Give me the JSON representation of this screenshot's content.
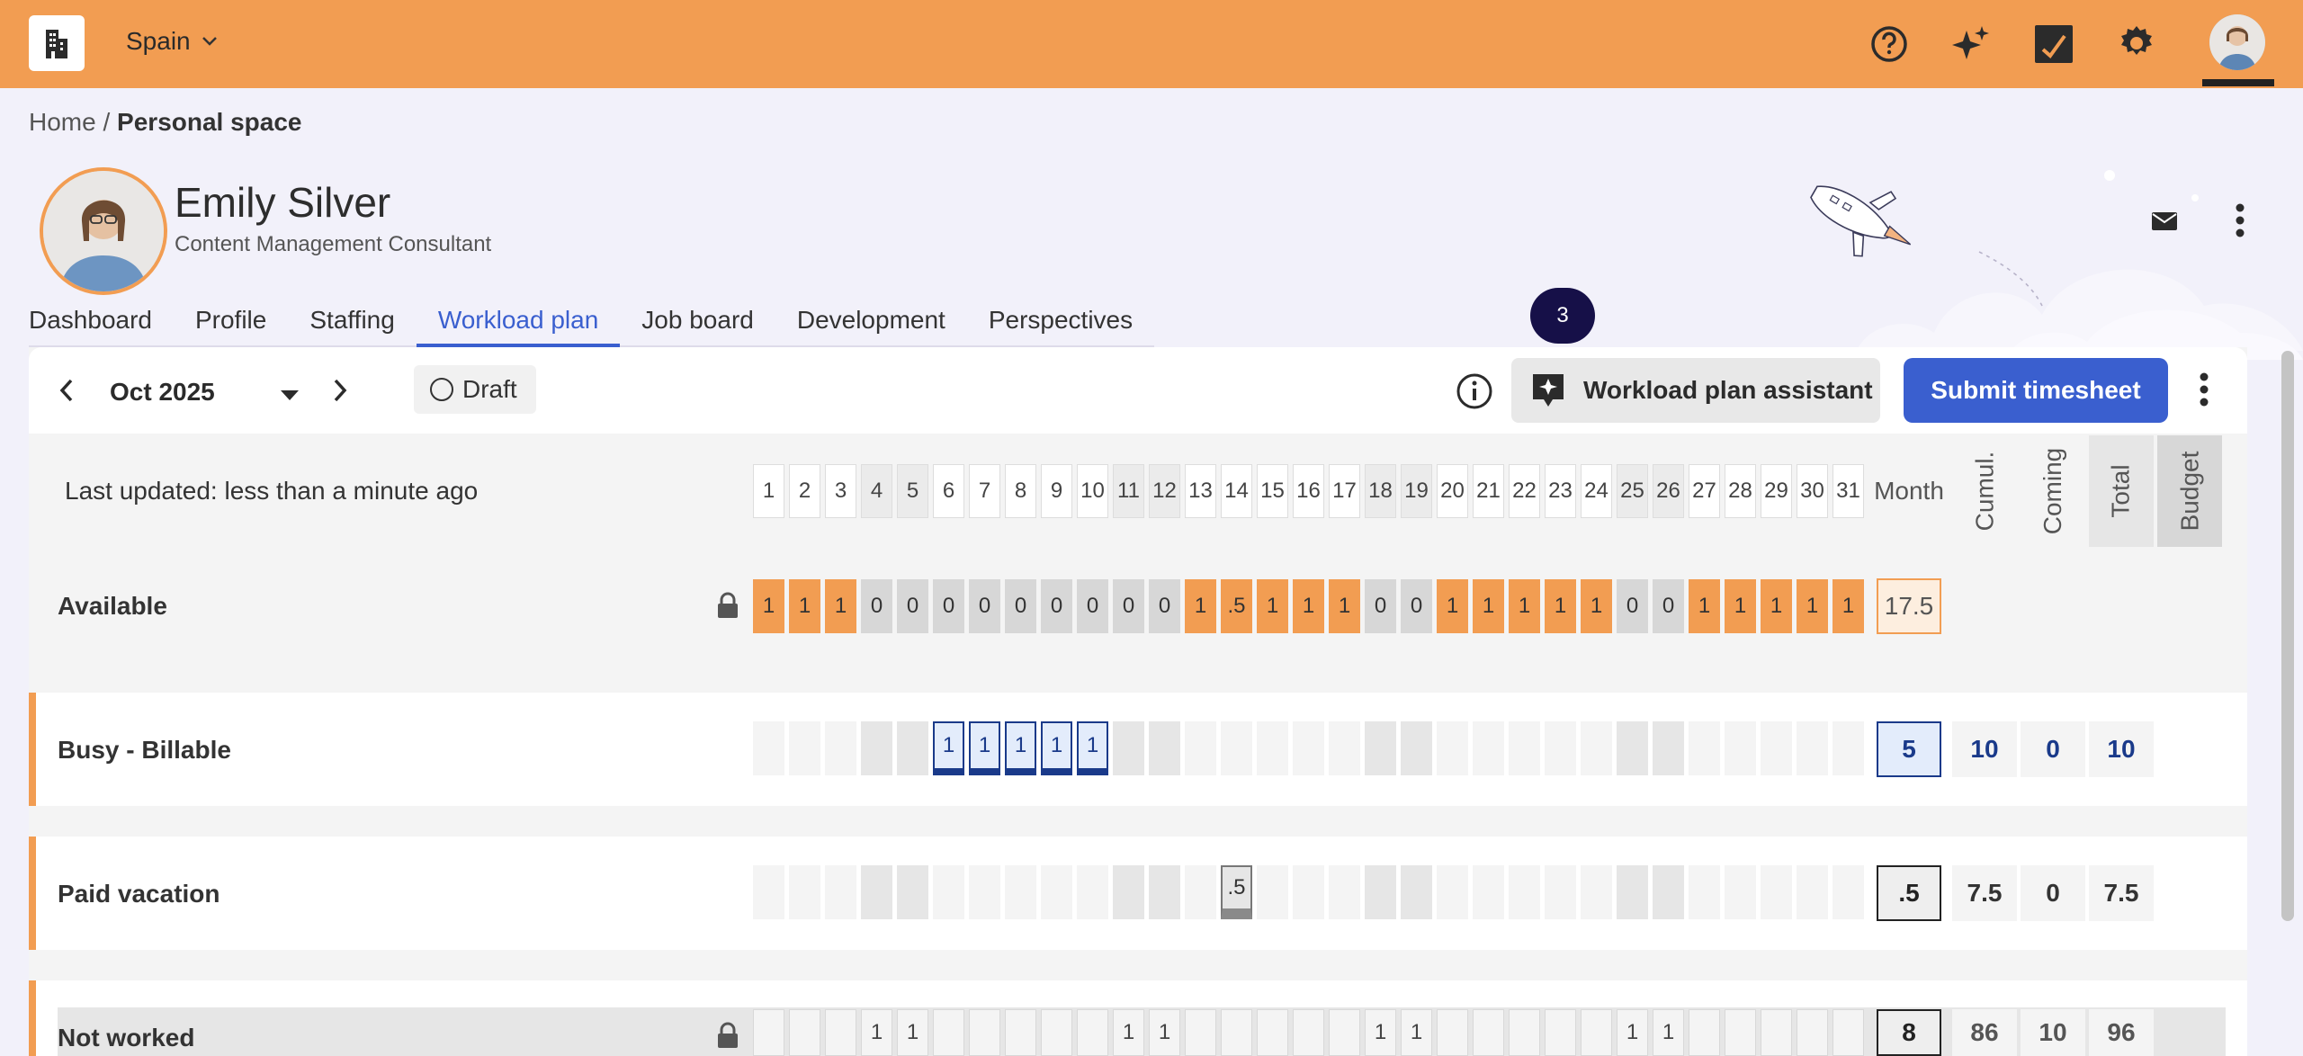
{
  "header": {
    "org": "Spain",
    "icons": [
      "building-icon",
      "help-icon",
      "sparkle-icon",
      "checkbox-icon",
      "gear-icon"
    ]
  },
  "breadcrumb": {
    "home": "Home",
    "separator": " / ",
    "current": "Personal space"
  },
  "profile": {
    "name": "Emily Silver",
    "role": "Content Management Consultant"
  },
  "tabs": [
    "Dashboard",
    "Profile",
    "Staffing",
    "Workload plan",
    "Job board",
    "Development",
    "Perspectives"
  ],
  "active_tab": "Workload plan",
  "tab_badge": "3",
  "toolbar": {
    "month": "Oct 2025",
    "status": "Draft",
    "assistant_label": "Workload plan assistant",
    "submit_label": "Submit timesheet"
  },
  "grid": {
    "last_updated": "Last updated: less than a minute ago",
    "days": [
      "1",
      "2",
      "3",
      "4",
      "5",
      "6",
      "7",
      "8",
      "9",
      "10",
      "11",
      "12",
      "13",
      "14",
      "15",
      "16",
      "17",
      "18",
      "19",
      "20",
      "21",
      "22",
      "23",
      "24",
      "25",
      "26",
      "27",
      "28",
      "29",
      "30",
      "31"
    ],
    "weekend_days": [
      4,
      5,
      11,
      12,
      18,
      19,
      25,
      26
    ],
    "month_header": "Month",
    "cumul_header": "Cumul.",
    "coming_header": "Coming",
    "total_header": "Total",
    "budget_header": "Budget",
    "rows": {
      "available": {
        "label": "Available",
        "values": [
          "1",
          "1",
          "1",
          "0",
          "0",
          "0",
          "0",
          "0",
          "0",
          "0",
          "0",
          "0",
          "1",
          ".5",
          "1",
          "1",
          "1",
          "0",
          "0",
          "1",
          "1",
          "1",
          "1",
          "1",
          "0",
          "0",
          "1",
          "1",
          "1",
          "1",
          "1"
        ],
        "month": "17.5"
      },
      "busy": {
        "label": "Busy - Billable",
        "values": {
          "6": "1",
          "7": "1",
          "8": "1",
          "9": "1",
          "10": "1"
        },
        "month": "5",
        "cumul": "10",
        "coming": "0",
        "total": "10"
      },
      "paid_vacation": {
        "label": "Paid vacation",
        "values": {
          "14": ".5"
        },
        "month": ".5",
        "cumul": "7.5",
        "coming": "0",
        "total": "7.5"
      },
      "not_worked": {
        "label": "Not worked",
        "values": {
          "4": "1",
          "5": "1",
          "11": "1",
          "12": "1",
          "18": "1",
          "19": "1",
          "25": "1",
          "26": "1"
        },
        "month": "8",
        "cumul": "86",
        "coming": "10",
        "total": "96"
      }
    }
  },
  "colors": {
    "brand": "#f29d52",
    "primary": "#3a5fcf",
    "billable": "#1a3a8a"
  }
}
